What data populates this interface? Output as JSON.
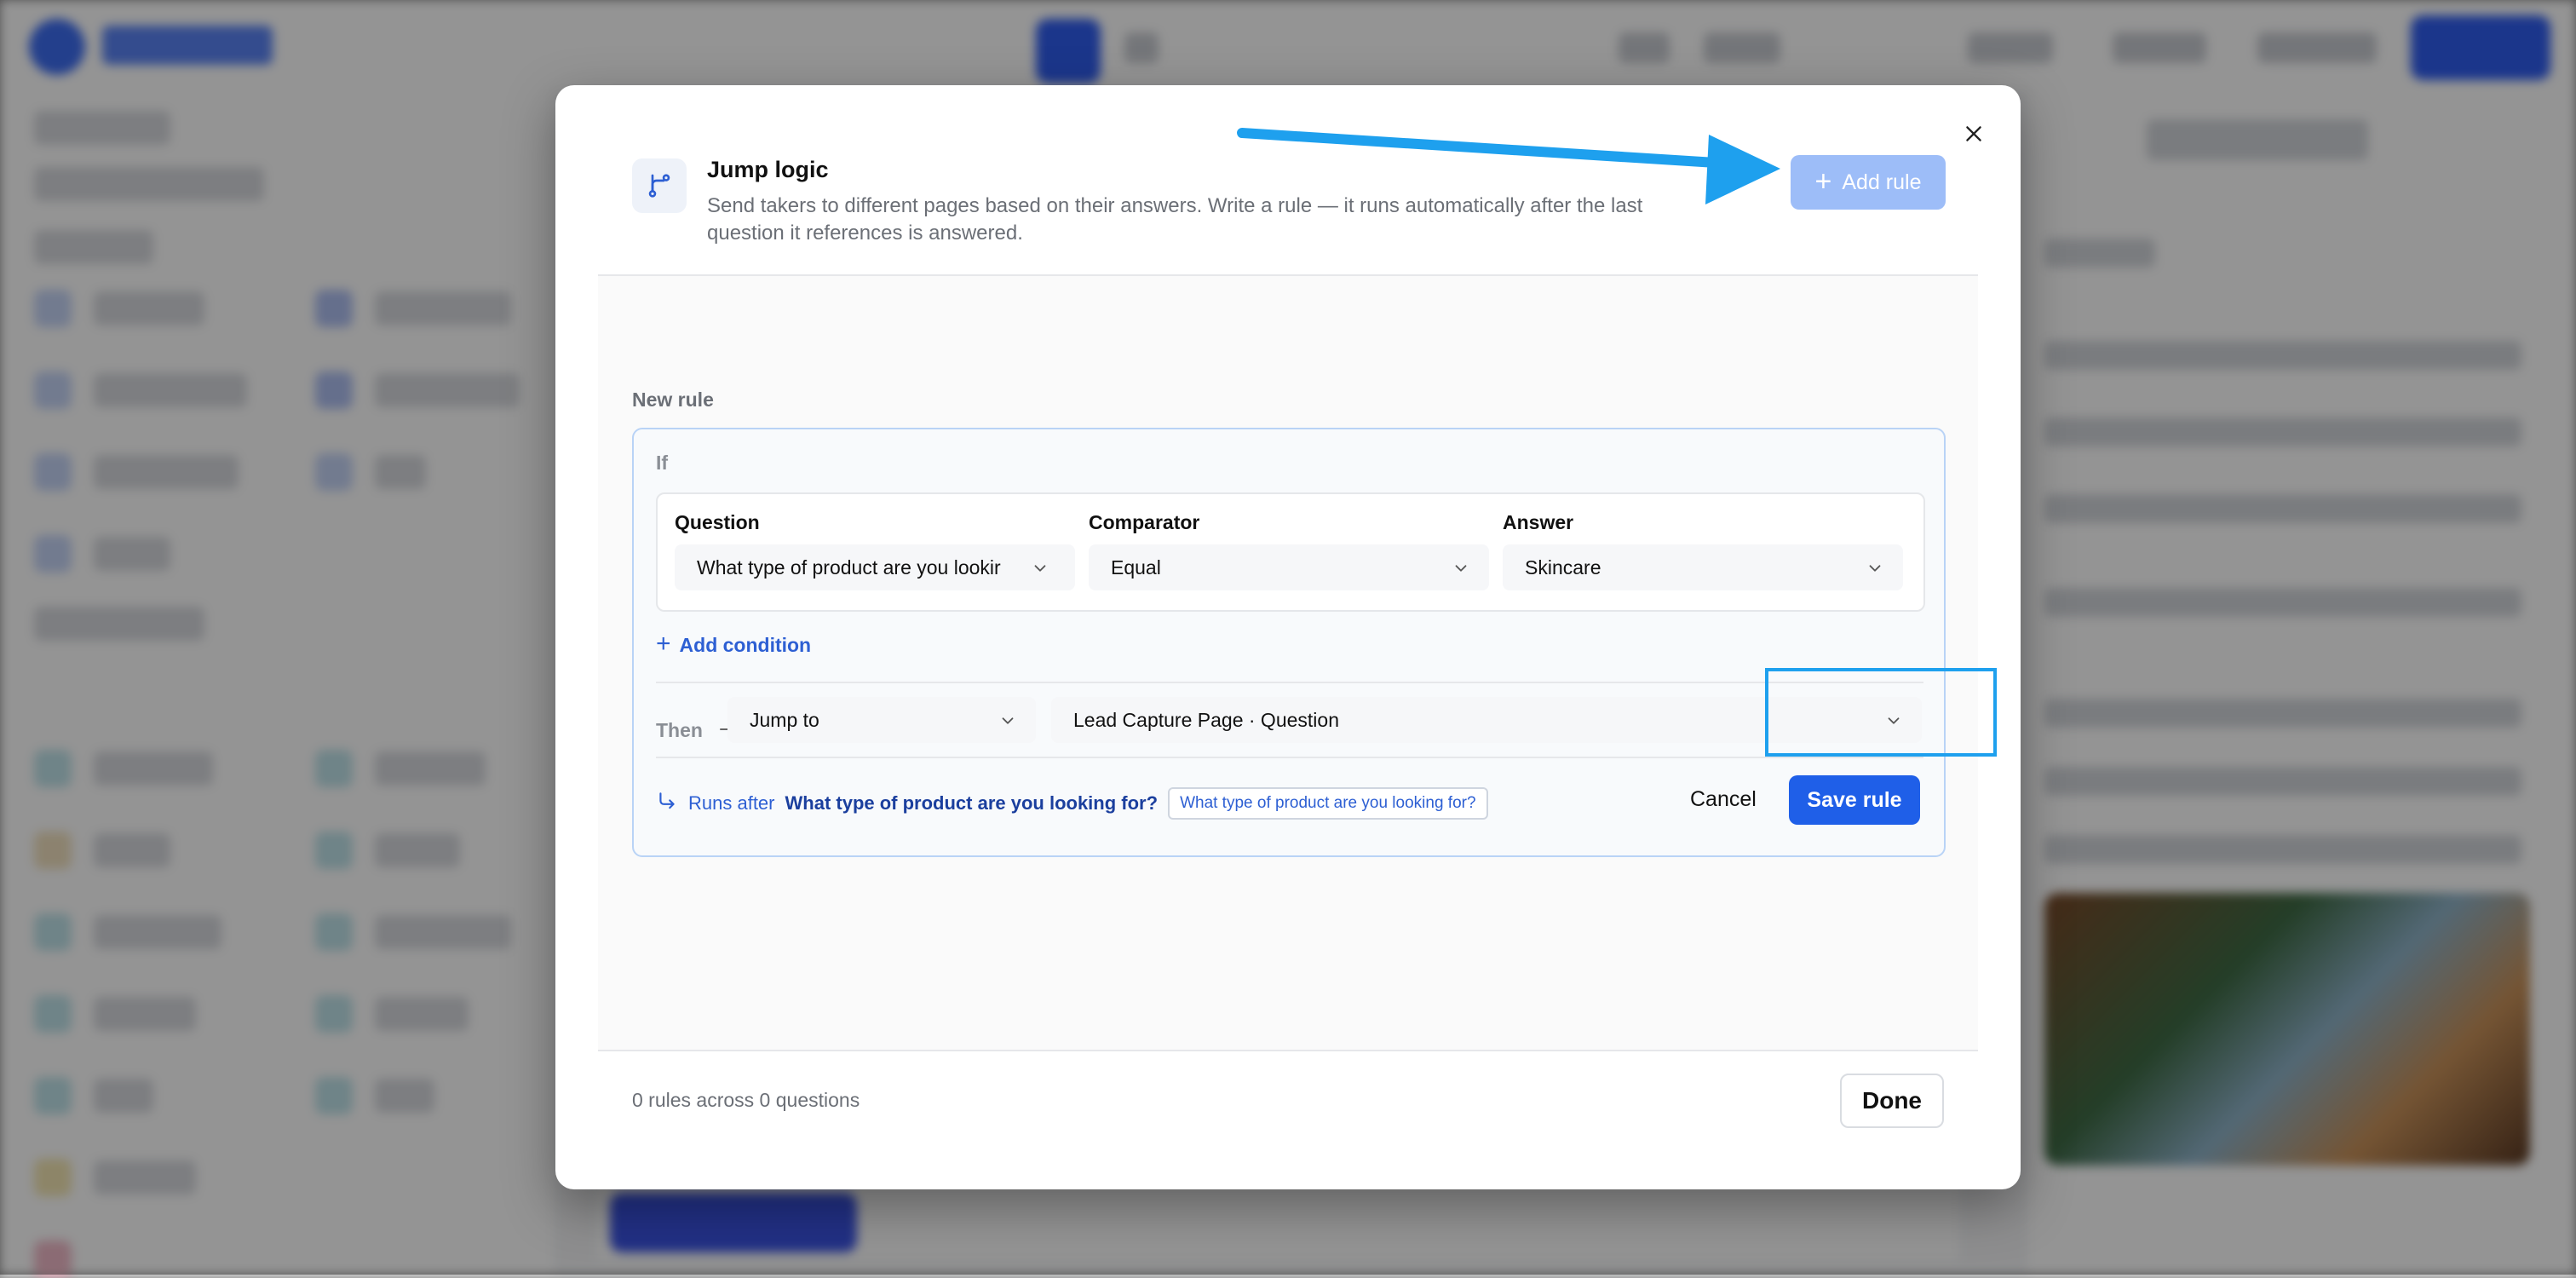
{
  "modal": {
    "title": "Jump logic",
    "description": "Send takers to different pages based on their answers. Write a rule — it runs automatically after the last question it references is answered.",
    "add_rule_label": "Add rule",
    "new_rule_label": "New rule",
    "if_label": "If",
    "condition": {
      "question_label": "Question",
      "question_value": "What type of product are you lookir",
      "comparator_label": "Comparator",
      "comparator_value": "Equal",
      "answer_label": "Answer",
      "answer_value": "Skincare"
    },
    "add_condition_label": "Add condition",
    "then_label": "Then",
    "action_value": "Jump to",
    "target_value": "Lead Capture Page · Question",
    "runs_after_label": "Runs after",
    "runs_after_question": "What type of product are you looking for?",
    "runs_after_chip": "What type of product are you looking for?",
    "cancel_label": "Cancel",
    "save_label": "Save rule",
    "summary": "0 rules across 0 questions",
    "done_label": "Done"
  },
  "colors": {
    "accent": "#1f5fe8",
    "add_rule_disabled": "#9dbdf8",
    "annotation": "#1ea0ee",
    "link": "#2d5fd3"
  },
  "icons": {
    "header": "branch-icon",
    "close": "close-icon",
    "chevron": "chevron-down-icon",
    "then_arrow": "arrow-right-icon",
    "runs_after": "return-arrow-icon"
  }
}
